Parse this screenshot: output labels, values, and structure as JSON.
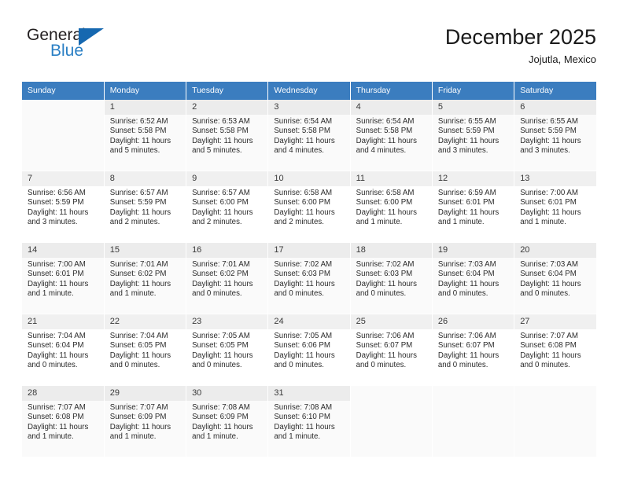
{
  "brand": {
    "name_top": "General",
    "name_bottom": "Blue",
    "accent_color": "#2a7fc4",
    "triangle_color": "#1668b0"
  },
  "header": {
    "title": "December 2025",
    "subtitle": "Jojutla, Mexico"
  },
  "theme": {
    "header_row_bg": "#3b7dbf",
    "header_row_text": "#ffffff",
    "daynum_band_bg": "#f0f0f0",
    "alt_row_bg": "#fafafa"
  },
  "weekday_headers": [
    "Sunday",
    "Monday",
    "Tuesday",
    "Wednesday",
    "Thursday",
    "Friday",
    "Saturday"
  ],
  "labels": {
    "sunrise_prefix": "Sunrise:",
    "sunset_prefix": "Sunset:",
    "daylight_prefix": "Daylight:"
  },
  "weeks": [
    [
      {
        "day": "",
        "empty": true
      },
      {
        "day": "1",
        "sunrise": "Sunrise: 6:52 AM",
        "sunset": "Sunset: 5:58 PM",
        "daylight_line1": "Daylight: 11 hours",
        "daylight_line2": "and 5 minutes."
      },
      {
        "day": "2",
        "sunrise": "Sunrise: 6:53 AM",
        "sunset": "Sunset: 5:58 PM",
        "daylight_line1": "Daylight: 11 hours",
        "daylight_line2": "and 5 minutes."
      },
      {
        "day": "3",
        "sunrise": "Sunrise: 6:54 AM",
        "sunset": "Sunset: 5:58 PM",
        "daylight_line1": "Daylight: 11 hours",
        "daylight_line2": "and 4 minutes."
      },
      {
        "day": "4",
        "sunrise": "Sunrise: 6:54 AM",
        "sunset": "Sunset: 5:58 PM",
        "daylight_line1": "Daylight: 11 hours",
        "daylight_line2": "and 4 minutes."
      },
      {
        "day": "5",
        "sunrise": "Sunrise: 6:55 AM",
        "sunset": "Sunset: 5:59 PM",
        "daylight_line1": "Daylight: 11 hours",
        "daylight_line2": "and 3 minutes."
      },
      {
        "day": "6",
        "sunrise": "Sunrise: 6:55 AM",
        "sunset": "Sunset: 5:59 PM",
        "daylight_line1": "Daylight: 11 hours",
        "daylight_line2": "and 3 minutes."
      }
    ],
    [
      {
        "day": "7",
        "sunrise": "Sunrise: 6:56 AM",
        "sunset": "Sunset: 5:59 PM",
        "daylight_line1": "Daylight: 11 hours",
        "daylight_line2": "and 3 minutes."
      },
      {
        "day": "8",
        "sunrise": "Sunrise: 6:57 AM",
        "sunset": "Sunset: 5:59 PM",
        "daylight_line1": "Daylight: 11 hours",
        "daylight_line2": "and 2 minutes."
      },
      {
        "day": "9",
        "sunrise": "Sunrise: 6:57 AM",
        "sunset": "Sunset: 6:00 PM",
        "daylight_line1": "Daylight: 11 hours",
        "daylight_line2": "and 2 minutes."
      },
      {
        "day": "10",
        "sunrise": "Sunrise: 6:58 AM",
        "sunset": "Sunset: 6:00 PM",
        "daylight_line1": "Daylight: 11 hours",
        "daylight_line2": "and 2 minutes."
      },
      {
        "day": "11",
        "sunrise": "Sunrise: 6:58 AM",
        "sunset": "Sunset: 6:00 PM",
        "daylight_line1": "Daylight: 11 hours",
        "daylight_line2": "and 1 minute."
      },
      {
        "day": "12",
        "sunrise": "Sunrise: 6:59 AM",
        "sunset": "Sunset: 6:01 PM",
        "daylight_line1": "Daylight: 11 hours",
        "daylight_line2": "and 1 minute."
      },
      {
        "day": "13",
        "sunrise": "Sunrise: 7:00 AM",
        "sunset": "Sunset: 6:01 PM",
        "daylight_line1": "Daylight: 11 hours",
        "daylight_line2": "and 1 minute."
      }
    ],
    [
      {
        "day": "14",
        "sunrise": "Sunrise: 7:00 AM",
        "sunset": "Sunset: 6:01 PM",
        "daylight_line1": "Daylight: 11 hours",
        "daylight_line2": "and 1 minute."
      },
      {
        "day": "15",
        "sunrise": "Sunrise: 7:01 AM",
        "sunset": "Sunset: 6:02 PM",
        "daylight_line1": "Daylight: 11 hours",
        "daylight_line2": "and 1 minute."
      },
      {
        "day": "16",
        "sunrise": "Sunrise: 7:01 AM",
        "sunset": "Sunset: 6:02 PM",
        "daylight_line1": "Daylight: 11 hours",
        "daylight_line2": "and 0 minutes."
      },
      {
        "day": "17",
        "sunrise": "Sunrise: 7:02 AM",
        "sunset": "Sunset: 6:03 PM",
        "daylight_line1": "Daylight: 11 hours",
        "daylight_line2": "and 0 minutes."
      },
      {
        "day": "18",
        "sunrise": "Sunrise: 7:02 AM",
        "sunset": "Sunset: 6:03 PM",
        "daylight_line1": "Daylight: 11 hours",
        "daylight_line2": "and 0 minutes."
      },
      {
        "day": "19",
        "sunrise": "Sunrise: 7:03 AM",
        "sunset": "Sunset: 6:04 PM",
        "daylight_line1": "Daylight: 11 hours",
        "daylight_line2": "and 0 minutes."
      },
      {
        "day": "20",
        "sunrise": "Sunrise: 7:03 AM",
        "sunset": "Sunset: 6:04 PM",
        "daylight_line1": "Daylight: 11 hours",
        "daylight_line2": "and 0 minutes."
      }
    ],
    [
      {
        "day": "21",
        "sunrise": "Sunrise: 7:04 AM",
        "sunset": "Sunset: 6:04 PM",
        "daylight_line1": "Daylight: 11 hours",
        "daylight_line2": "and 0 minutes."
      },
      {
        "day": "22",
        "sunrise": "Sunrise: 7:04 AM",
        "sunset": "Sunset: 6:05 PM",
        "daylight_line1": "Daylight: 11 hours",
        "daylight_line2": "and 0 minutes."
      },
      {
        "day": "23",
        "sunrise": "Sunrise: 7:05 AM",
        "sunset": "Sunset: 6:05 PM",
        "daylight_line1": "Daylight: 11 hours",
        "daylight_line2": "and 0 minutes."
      },
      {
        "day": "24",
        "sunrise": "Sunrise: 7:05 AM",
        "sunset": "Sunset: 6:06 PM",
        "daylight_line1": "Daylight: 11 hours",
        "daylight_line2": "and 0 minutes."
      },
      {
        "day": "25",
        "sunrise": "Sunrise: 7:06 AM",
        "sunset": "Sunset: 6:07 PM",
        "daylight_line1": "Daylight: 11 hours",
        "daylight_line2": "and 0 minutes."
      },
      {
        "day": "26",
        "sunrise": "Sunrise: 7:06 AM",
        "sunset": "Sunset: 6:07 PM",
        "daylight_line1": "Daylight: 11 hours",
        "daylight_line2": "and 0 minutes."
      },
      {
        "day": "27",
        "sunrise": "Sunrise: 7:07 AM",
        "sunset": "Sunset: 6:08 PM",
        "daylight_line1": "Daylight: 11 hours",
        "daylight_line2": "and 0 minutes."
      }
    ],
    [
      {
        "day": "28",
        "sunrise": "Sunrise: 7:07 AM",
        "sunset": "Sunset: 6:08 PM",
        "daylight_line1": "Daylight: 11 hours",
        "daylight_line2": "and 1 minute."
      },
      {
        "day": "29",
        "sunrise": "Sunrise: 7:07 AM",
        "sunset": "Sunset: 6:09 PM",
        "daylight_line1": "Daylight: 11 hours",
        "daylight_line2": "and 1 minute."
      },
      {
        "day": "30",
        "sunrise": "Sunrise: 7:08 AM",
        "sunset": "Sunset: 6:09 PM",
        "daylight_line1": "Daylight: 11 hours",
        "daylight_line2": "and 1 minute."
      },
      {
        "day": "31",
        "sunrise": "Sunrise: 7:08 AM",
        "sunset": "Sunset: 6:10 PM",
        "daylight_line1": "Daylight: 11 hours",
        "daylight_line2": "and 1 minute."
      },
      {
        "day": "",
        "empty": true
      },
      {
        "day": "",
        "empty": true
      },
      {
        "day": "",
        "empty": true
      }
    ]
  ]
}
